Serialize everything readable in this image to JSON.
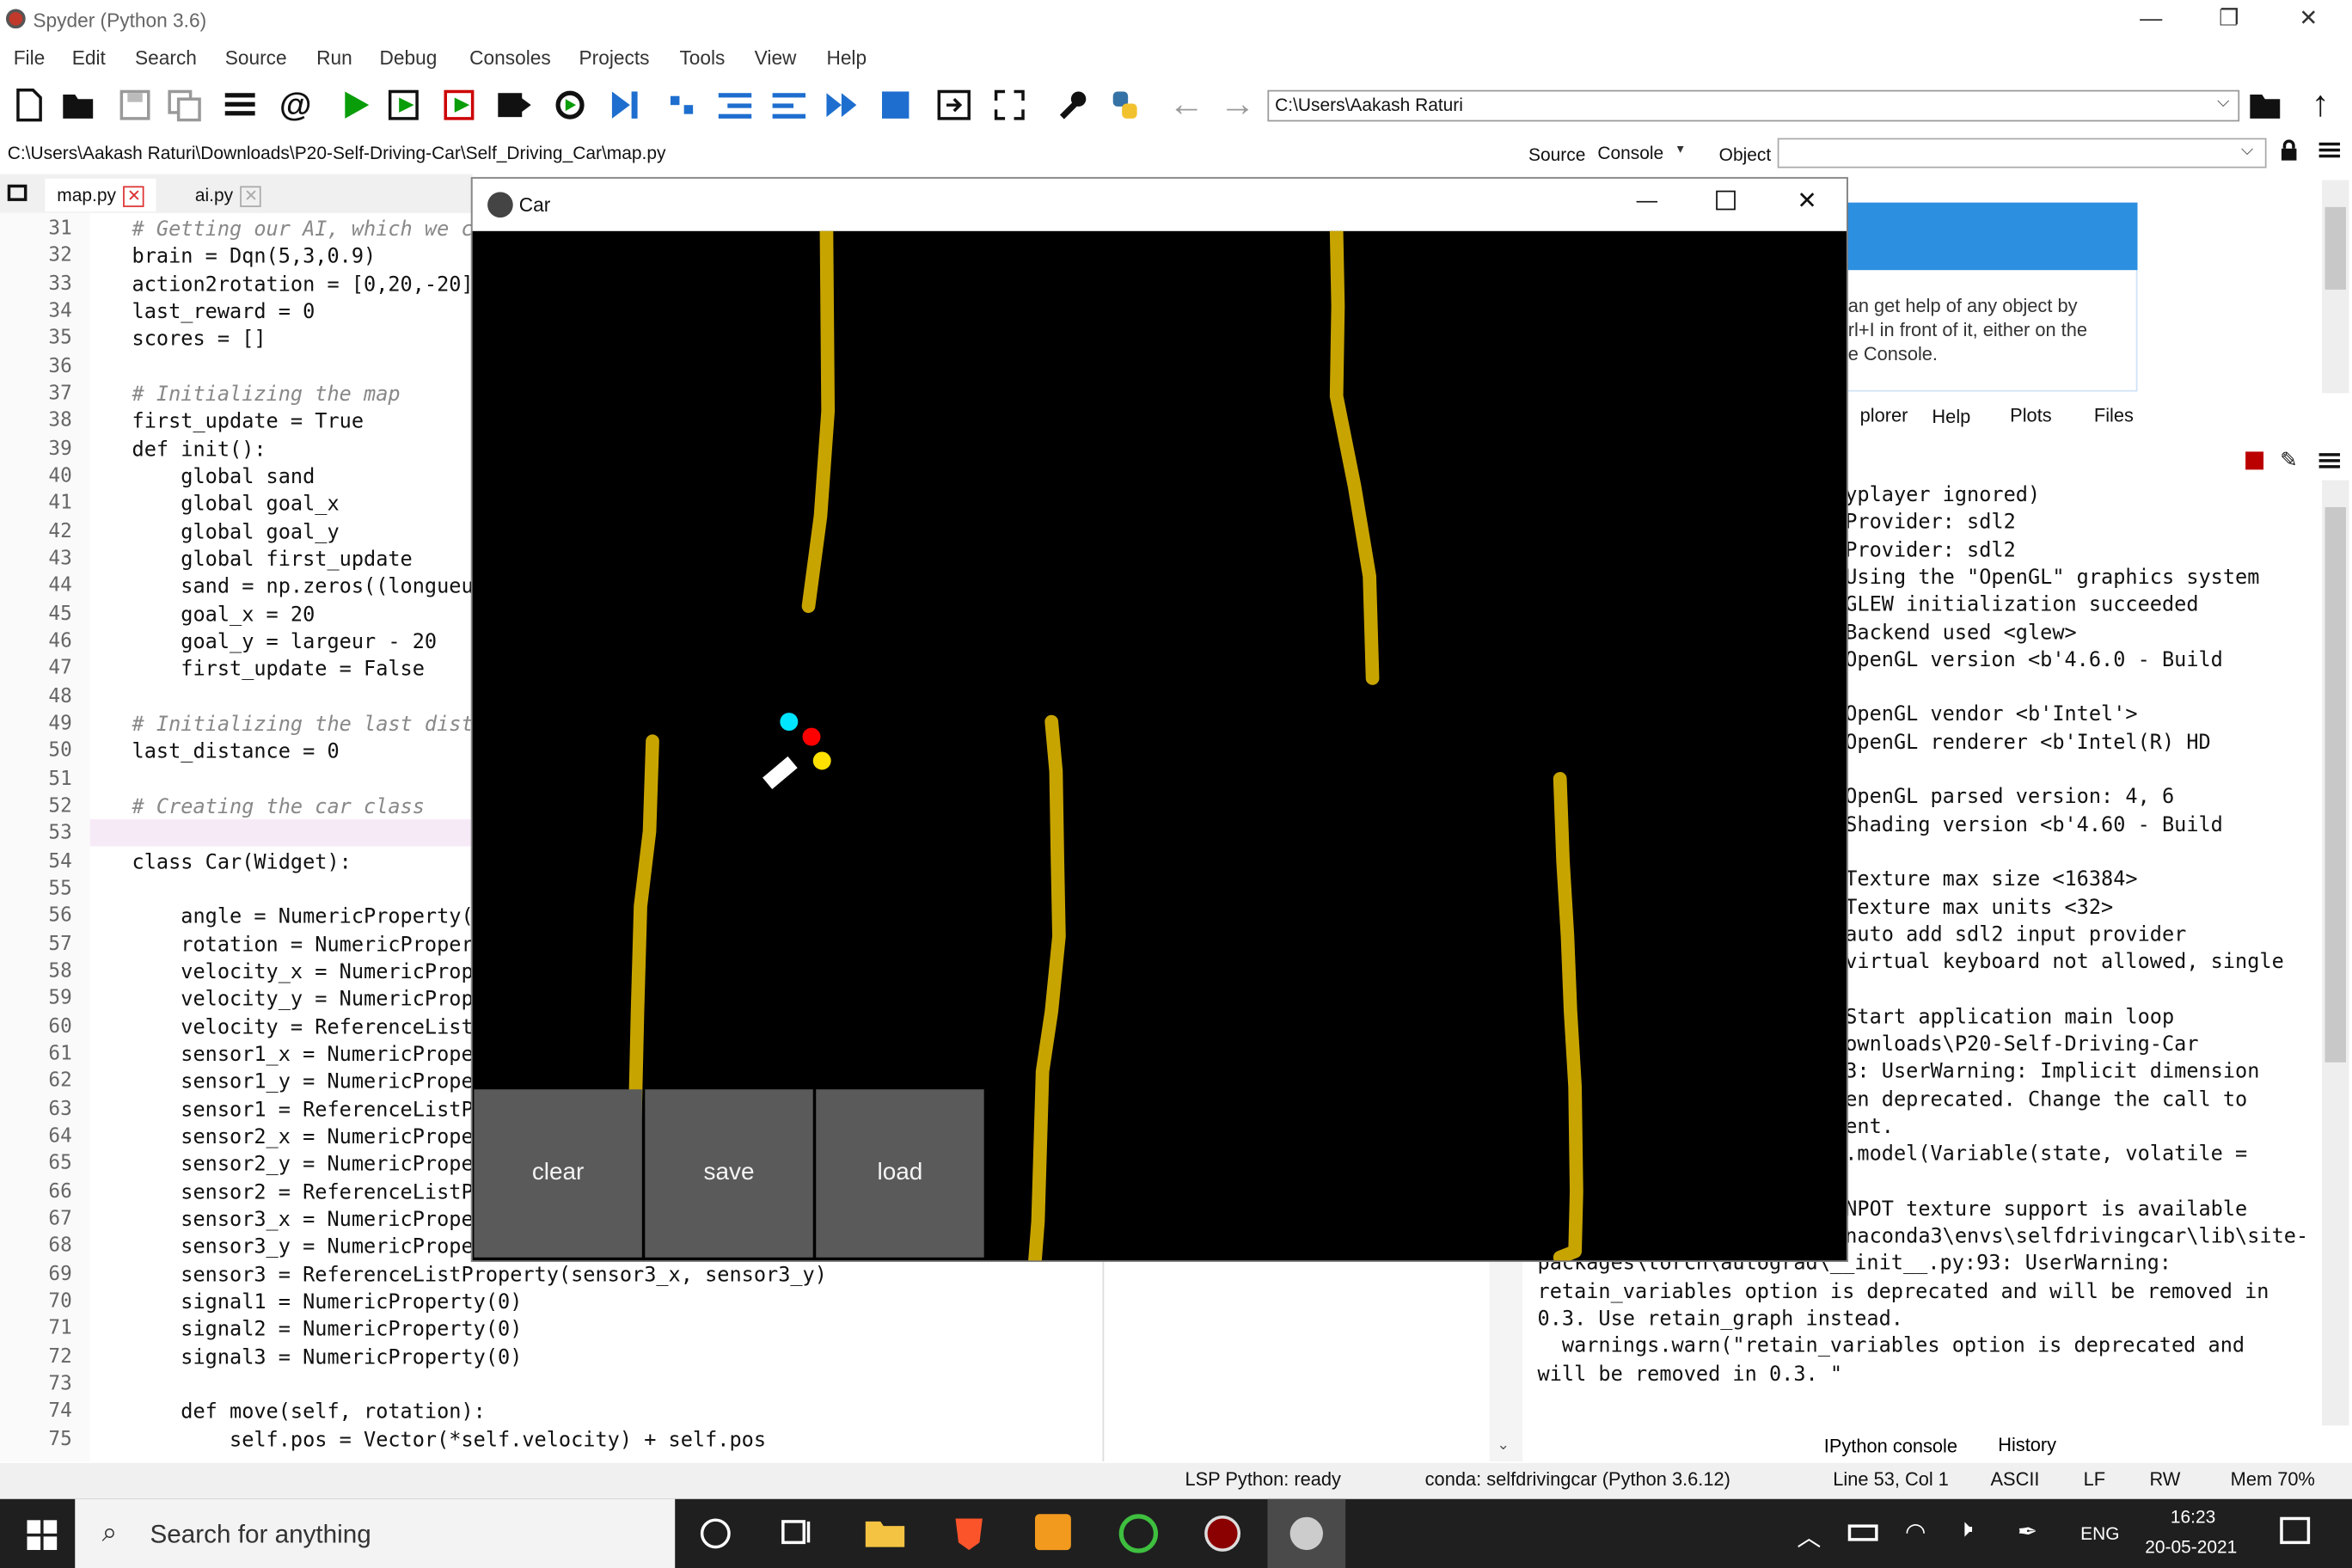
{
  "window": {
    "title": "Spyder (Python 3.6)",
    "minimize": "—",
    "maximize": "❐",
    "close": "✕"
  },
  "menu": [
    "File",
    "Edit",
    "Search",
    "Source",
    "Run",
    "Debug",
    "Consoles",
    "Projects",
    "Tools",
    "View",
    "Help"
  ],
  "toolbar": {
    "working_dir": "C:\\Users\\Aakash Raturi"
  },
  "file_path": "C:\\Users\\Aakash Raturi\\Downloads\\P20-Self-Driving-Car\\Self_Driving_Car\\map.py",
  "source_label": "Source",
  "source_value": "Console",
  "object_label": "Object",
  "editor_tabs": [
    {
      "label": "map.py",
      "close": "✕"
    },
    {
      "label": "ai.py",
      "close": "✕"
    }
  ],
  "code_lines": [
    {
      "n": "31",
      "t": "# Getting our AI, which we c"
    },
    {
      "n": "32",
      "t": "brain = Dqn(5,3,0.9)"
    },
    {
      "n": "33",
      "t": "action2rotation = [0,20,-20]"
    },
    {
      "n": "34",
      "t": "last_reward = 0"
    },
    {
      "n": "35",
      "t": "scores = []"
    },
    {
      "n": "36",
      "t": ""
    },
    {
      "n": "37",
      "t": "# Initializing the map"
    },
    {
      "n": "38",
      "t": "first_update = True"
    },
    {
      "n": "39",
      "t": "def init():"
    },
    {
      "n": "40",
      "t": "    global sand"
    },
    {
      "n": "41",
      "t": "    global goal_x"
    },
    {
      "n": "42",
      "t": "    global goal_y"
    },
    {
      "n": "43",
      "t": "    global first_update"
    },
    {
      "n": "44",
      "t": "    sand = np.zeros((longueu"
    },
    {
      "n": "45",
      "t": "    goal_x = 20"
    },
    {
      "n": "46",
      "t": "    goal_y = largeur - 20"
    },
    {
      "n": "47",
      "t": "    first_update = False"
    },
    {
      "n": "48",
      "t": ""
    },
    {
      "n": "49",
      "t": "# Initializing the last dist"
    },
    {
      "n": "50",
      "t": "last_distance = 0"
    },
    {
      "n": "51",
      "t": ""
    },
    {
      "n": "52",
      "t": "# Creating the car class"
    },
    {
      "n": "53",
      "t": ""
    },
    {
      "n": "54",
      "t": "class Car(Widget):"
    },
    {
      "n": "55",
      "t": ""
    },
    {
      "n": "56",
      "t": "    angle = NumericProperty("
    },
    {
      "n": "57",
      "t": "    rotation = NumericProper"
    },
    {
      "n": "58",
      "t": "    velocity_x = NumericProp"
    },
    {
      "n": "59",
      "t": "    velocity_y = NumericProp"
    },
    {
      "n": "60",
      "t": "    velocity = ReferenceList"
    },
    {
      "n": "61",
      "t": "    sensor1_x = NumericPrope"
    },
    {
      "n": "62",
      "t": "    sensor1_y = NumericPrope"
    },
    {
      "n": "63",
      "t": "    sensor1 = ReferenceListP"
    },
    {
      "n": "64",
      "t": "    sensor2_x = NumericPrope"
    },
    {
      "n": "65",
      "t": "    sensor2_y = NumericPrope"
    },
    {
      "n": "66",
      "t": "    sensor2 = ReferenceListP"
    },
    {
      "n": "67",
      "t": "    sensor3_x = NumericPrope"
    },
    {
      "n": "68",
      "t": "    sensor3_y = NumericPrope"
    },
    {
      "n": "69",
      "t": "    sensor3 = ReferenceListProperty(sensor3_x, sensor3_y)"
    },
    {
      "n": "70",
      "t": "    signal1 = NumericProperty(0)"
    },
    {
      "n": "71",
      "t": "    signal2 = NumericProperty(0)"
    },
    {
      "n": "72",
      "t": "    signal3 = NumericProperty(0)"
    },
    {
      "n": "73",
      "t": ""
    },
    {
      "n": "74",
      "t": "    def move(self, rotation):"
    },
    {
      "n": "75",
      "t": "        self.pos = Vector(*self.velocity) + self.pos"
    }
  ],
  "help": {
    "text": "an get help of any object by\nrl+I in front of it, either on the\ne Console."
  },
  "right_tabs": [
    "plorer",
    "Help",
    "Plots",
    "Files"
  ],
  "console_lines": [
    "yplayer ignored)",
    "Provider: sdl2",
    "Provider: sdl2",
    "Using the \"OpenGL\" graphics system",
    "GLEW initialization succeeded",
    "Backend used <glew>",
    "OpenGL version <b'4.6.0 - Build",
    "",
    "OpenGL vendor <b'Intel'>",
    "OpenGL renderer <b'Intel(R) HD",
    "",
    "OpenGL parsed version: 4, 6",
    "Shading version <b'4.60 - Build",
    "",
    "Texture max size <16384>",
    "Texture max units <32>",
    "auto add sdl2 input provider",
    "virtual keyboard not allowed, single",
    "",
    "Start application main loop",
    "ownloads\\P20-Self-Driving-Car",
    "3: UserWarning: Implicit dimension",
    "en deprecated. Change the call to",
    "ent.",
    ".model(Variable(state, volatile =",
    "",
    "NPOT texture support is available",
    "naconda3\\envs\\selfdrivingcar\\lib\\site-"
  ],
  "console_full_lines": [
    "packages\\torch\\autograd\\__init__.py:93: UserWarning:",
    "retain_variables option is deprecated and will be removed in",
    "0.3. Use retain_graph instead.",
    "  warnings.warn(\"retain_variables option is deprecated and",
    "will be removed in 0.3. \""
  ],
  "bottom_tabs": [
    "IPython console",
    "History"
  ],
  "status": {
    "lsp": "LSP Python: ready",
    "conda": "conda: selfdrivingcar (Python 3.6.12)",
    "position": "Line 53, Col 1",
    "encoding": "ASCII",
    "eol": "LF",
    "perm": "RW",
    "mem": "Mem 70%"
  },
  "kivy": {
    "title": "Car",
    "buttons": [
      "clear",
      "save",
      "load"
    ],
    "sand_color": "#c8a400",
    "sensor_colors": [
      "#00e5ff",
      "#ff0000",
      "#ffe000"
    ]
  },
  "taskbar": {
    "search": "Search for anything",
    "lang": "ENG",
    "time": "16:23",
    "date": "20-05-2021"
  }
}
